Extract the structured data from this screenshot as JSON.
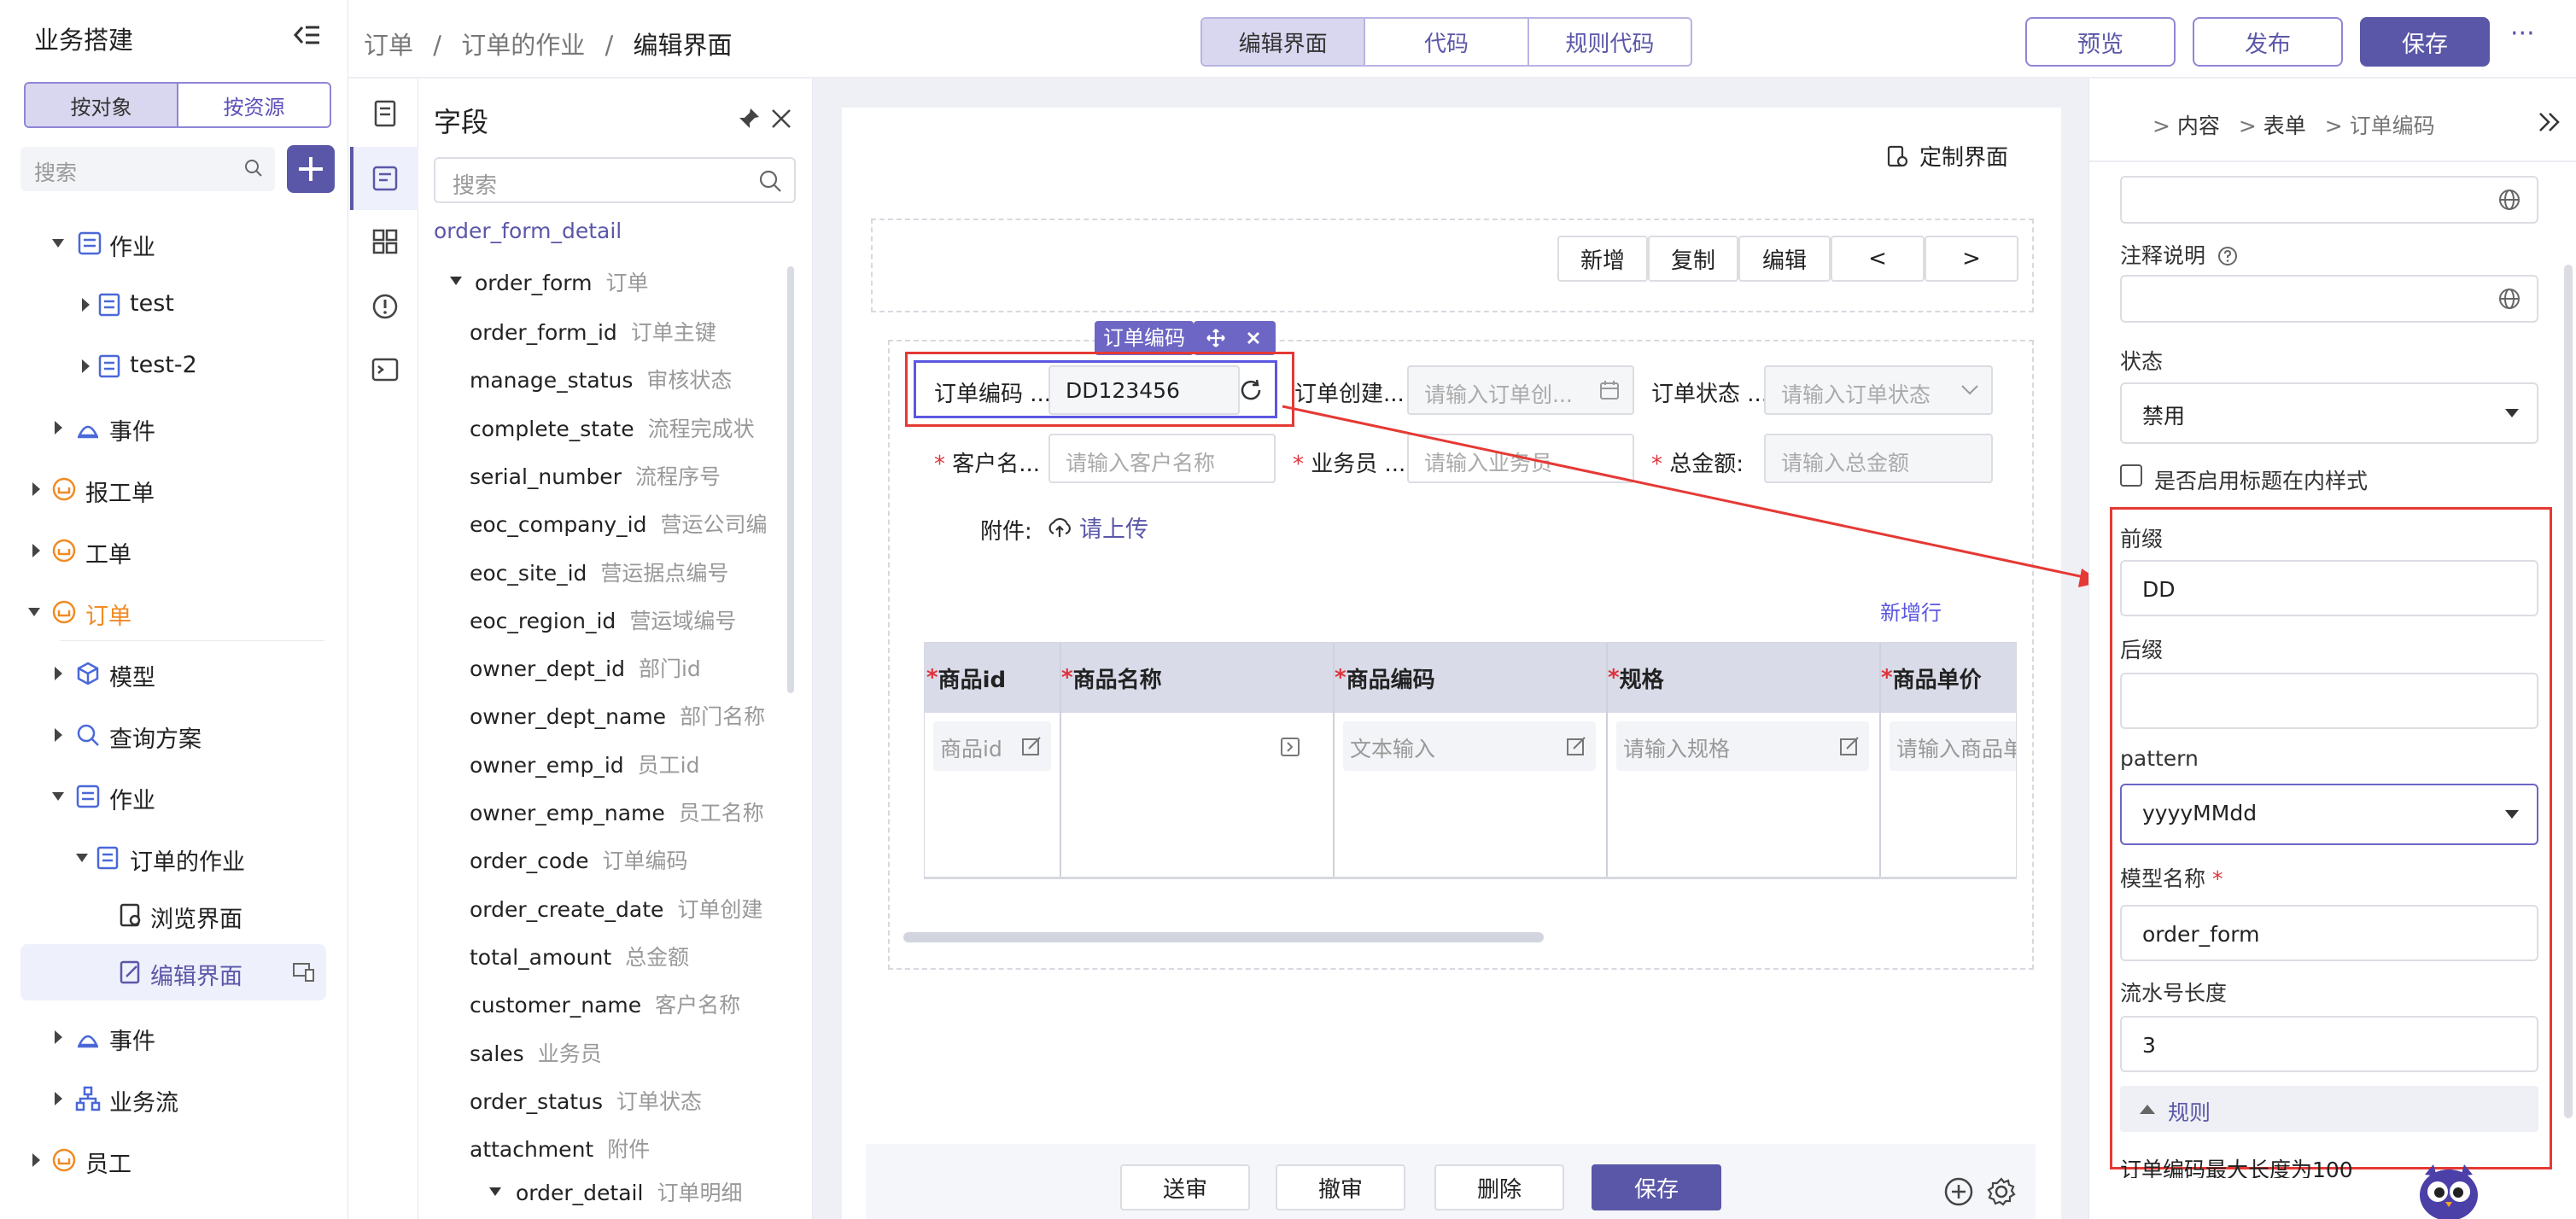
{
  "sidebar": {
    "title": "业务搭建",
    "seg": [
      "按对象",
      "按资源"
    ],
    "search_placeholder": "搜索",
    "tree": [
      {
        "label": "作业",
        "icon": "list-icon"
      },
      {
        "label": "test",
        "icon": "form-icon"
      },
      {
        "label": "test-2",
        "icon": "form-icon"
      },
      {
        "label": "事件",
        "icon": "event-icon"
      },
      {
        "label": "报工单",
        "icon": "object-icon"
      },
      {
        "label": "工单",
        "icon": "object-icon"
      },
      {
        "label": "订单",
        "icon": "object-icon"
      },
      {
        "label": "模型",
        "icon": "cube-icon"
      },
      {
        "label": "查询方案",
        "icon": "query-icon"
      },
      {
        "label": "作业",
        "icon": "list-icon"
      },
      {
        "label": "订单的作业",
        "icon": "form-icon"
      },
      {
        "label": "浏览界面",
        "icon": "page-icon"
      },
      {
        "label": "编辑界面",
        "icon": "edit-page-icon"
      },
      {
        "label": "事件",
        "icon": "event-icon"
      },
      {
        "label": "业务流",
        "icon": "flow-icon"
      },
      {
        "label": "员工",
        "icon": "object-icon"
      }
    ]
  },
  "header": {
    "breadcrumb": [
      "订单",
      "订单的作业",
      "编辑界面"
    ],
    "sep": "/",
    "tabs": [
      "编辑界面",
      "代码",
      "规则代码"
    ],
    "preview": "预览",
    "publish": "发布",
    "save": "保存",
    "more": "···"
  },
  "fields": {
    "title": "字段",
    "search_placeholder": "搜索",
    "root": "order_form_detail",
    "group": {
      "name": "order_form",
      "cn": "订单"
    },
    "items": [
      {
        "name": "order_form_id",
        "cn": "订单主键"
      },
      {
        "name": "manage_status",
        "cn": "审核状态"
      },
      {
        "name": "complete_state",
        "cn": "流程完成状"
      },
      {
        "name": "serial_number",
        "cn": "流程序号"
      },
      {
        "name": "eoc_company_id",
        "cn": "营运公司编"
      },
      {
        "name": "eoc_site_id",
        "cn": "营运据点编号"
      },
      {
        "name": "eoc_region_id",
        "cn": "营运域编号"
      },
      {
        "name": "owner_dept_id",
        "cn": "部门id"
      },
      {
        "name": "owner_dept_name",
        "cn": "部门名称"
      },
      {
        "name": "owner_emp_id",
        "cn": "员工id"
      },
      {
        "name": "owner_emp_name",
        "cn": "员工名称"
      },
      {
        "name": "order_code",
        "cn": "订单编码"
      },
      {
        "name": "order_create_date",
        "cn": "订单创建"
      },
      {
        "name": "total_amount",
        "cn": "总金额"
      },
      {
        "name": "customer_name",
        "cn": "客户名称"
      },
      {
        "name": "sales",
        "cn": "业务员"
      },
      {
        "name": "order_status",
        "cn": "订单状态"
      },
      {
        "name": "attachment",
        "cn": "附件"
      }
    ],
    "sub": {
      "name": "order_detail",
      "cn": "订单明细"
    }
  },
  "canvas": {
    "custom_ui": "定制界面",
    "toolbar": [
      "新增",
      "复制",
      "编辑",
      "<",
      ">"
    ],
    "selected_tag": "订单编码",
    "form": {
      "order_code_label": "订单编码 ...",
      "order_code_value": "DD123456",
      "create_label": "订单创建...",
      "create_placeholder": "请输入订单创...",
      "status_label": "订单状态 ...",
      "status_placeholder": "请输入订单状态",
      "customer_label": "客户名...",
      "customer_placeholder": "请输入客户名称",
      "sales_label": "业务员 ...",
      "sales_placeholder": "请输入业务员",
      "amount_label": "总金额:",
      "amount_placeholder": "请输入总金额",
      "attach_label": "附件:",
      "upload": "请上传",
      "required": "*"
    },
    "add_row": "新增行",
    "table": {
      "headers": [
        "商品id",
        "商品名称",
        "商品编码",
        "规格",
        "商品单价"
      ],
      "cells": [
        "商品id",
        "",
        "文本输入",
        "请输入规格",
        "请输入商品单"
      ]
    },
    "bottom_buttons": [
      "送审",
      "撤审",
      "删除",
      "保存"
    ]
  },
  "right": {
    "breadcrumb": [
      "内容",
      "表单",
      "订单编码"
    ],
    "note_label": "注释说明",
    "state_label": "状态",
    "state_value": "禁用",
    "checkbox_label": "是否启用标题在内样式",
    "prefix_label": "前缀",
    "prefix_value": "DD",
    "suffix_label": "后缀",
    "suffix_value": "",
    "pattern_label": "pattern",
    "pattern_value": "yyyyMMdd",
    "model_label": "模型名称",
    "model_value": "order_form",
    "serial_label": "流水号长度",
    "serial_value": "3",
    "rules": "规则",
    "rule_text": "订单编码最大长度为100"
  },
  "colors": {
    "accent": "#5b57a8",
    "highlight": "#e53935",
    "table_header": "#d9dbe8"
  }
}
